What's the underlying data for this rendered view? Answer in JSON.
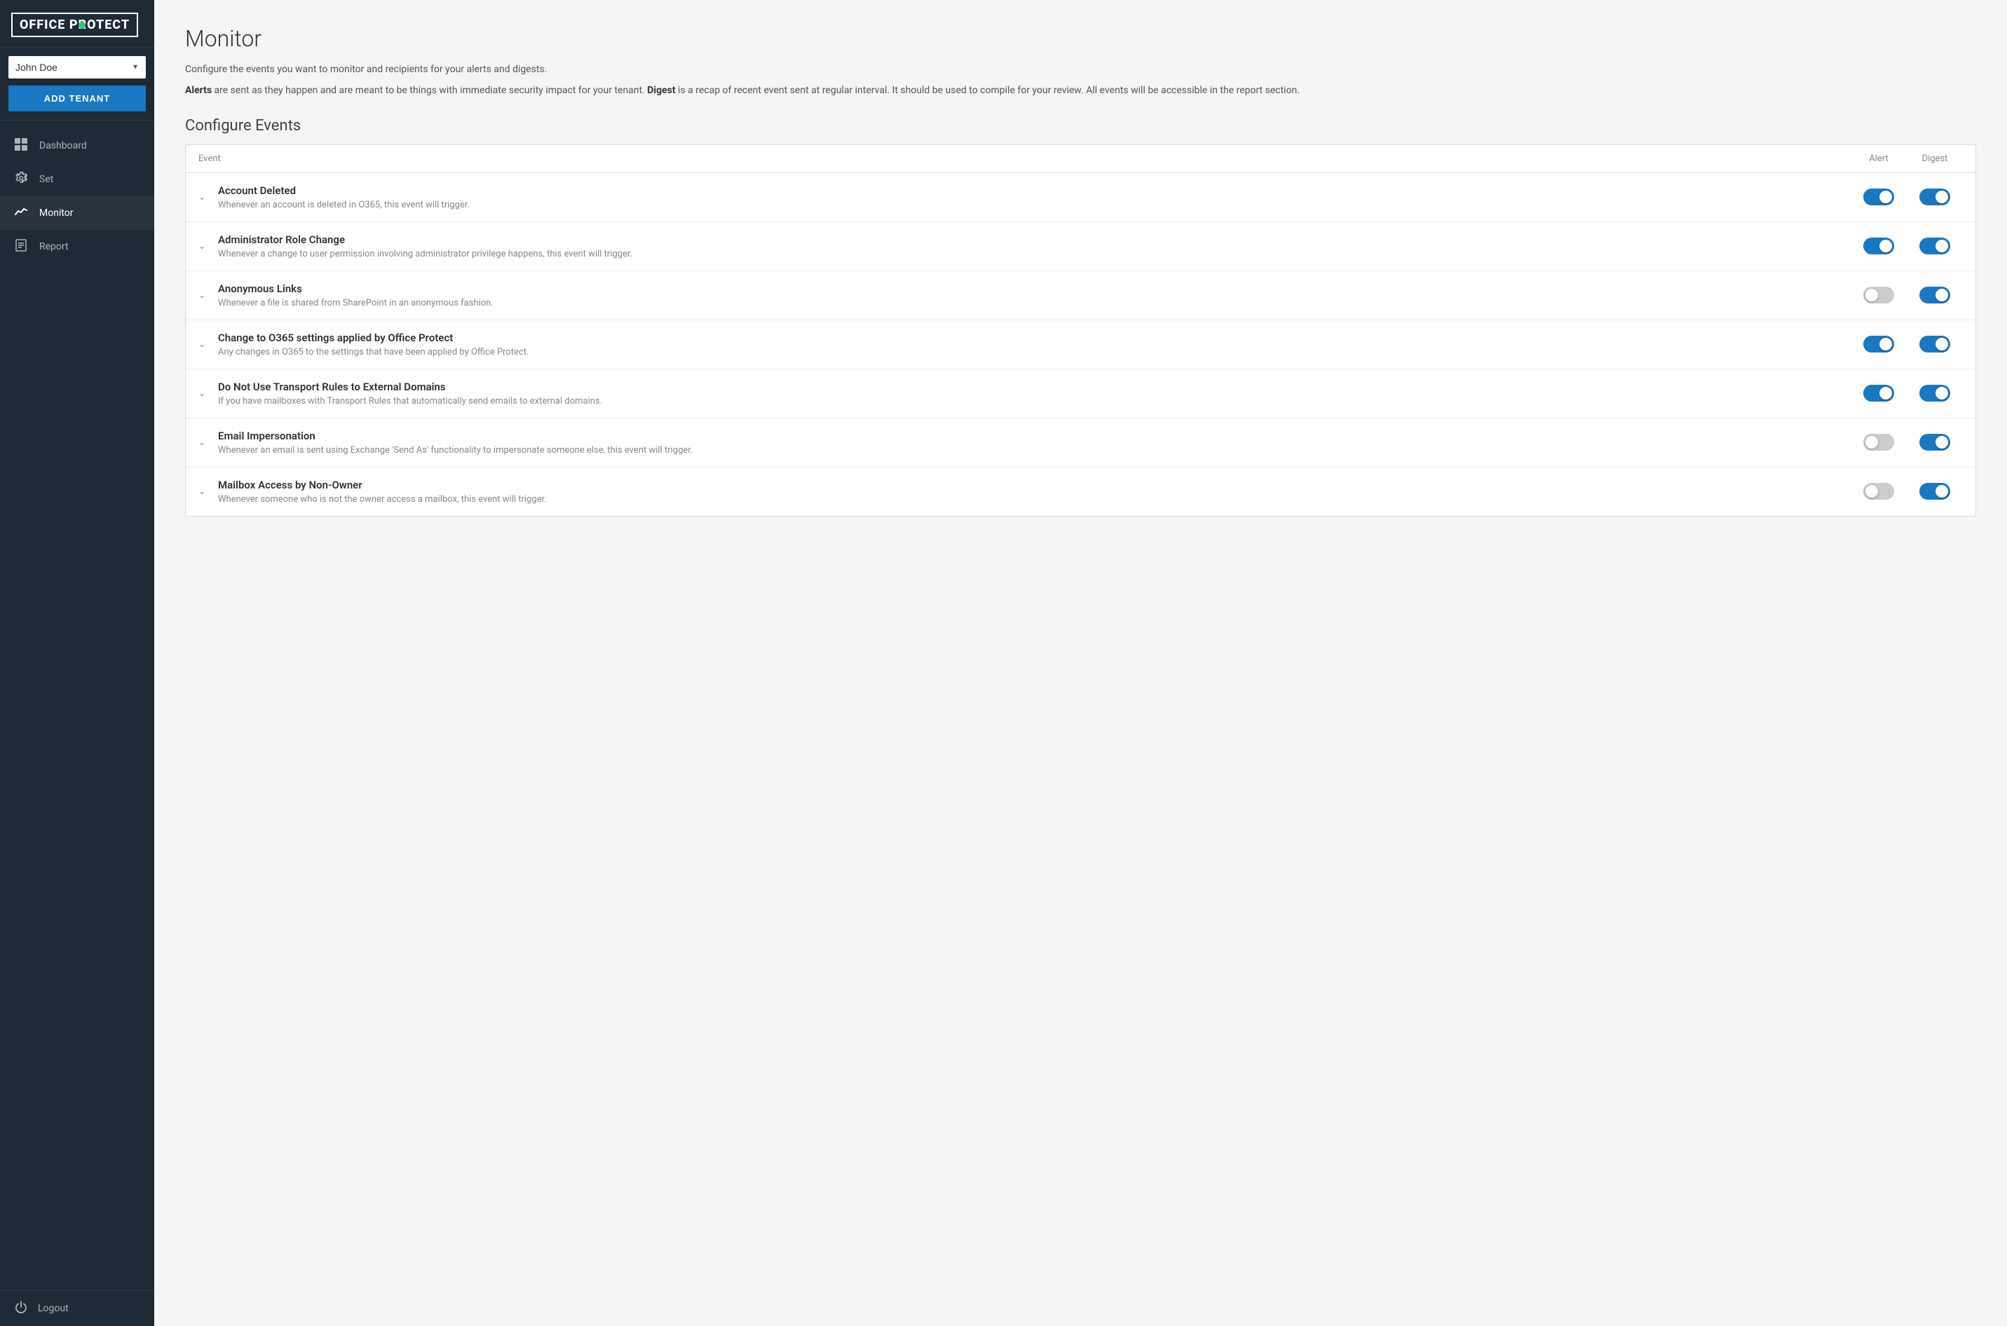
{
  "sidebar": {
    "logo_text": "OFFICE PROTECT",
    "logo_dot_color": "#2ecc71",
    "tenant": {
      "selected": "John Doe",
      "options": [
        "John Doe"
      ]
    },
    "add_tenant_label": "ADD TENANT",
    "nav_items": [
      {
        "id": "dashboard",
        "label": "Dashboard",
        "icon": "grid",
        "active": false
      },
      {
        "id": "set",
        "label": "Set",
        "icon": "gear",
        "active": false
      },
      {
        "id": "monitor",
        "label": "Monitor",
        "icon": "chart",
        "active": true
      },
      {
        "id": "report",
        "label": "Report",
        "icon": "file",
        "active": false
      }
    ],
    "logout_label": "Logout",
    "logout_icon": "power"
  },
  "main": {
    "page_title": "Monitor",
    "intro_line1": "Configure the events you want to monitor and recipients for your alerts and digests.",
    "intro_line2_bold_alerts": "Alerts",
    "intro_line2_after_alerts": " are sent as they happen and are meant to be things with immediate security impact for your tenant.",
    "intro_line2_bold_digest": "Digest",
    "intro_line2_after_digest": " is a recap of recent event sent at regular interval. It should be used to compile for your review. All events will be accessible in the report section.",
    "configure_events_title": "Configure Events",
    "table": {
      "col_event": "Event",
      "col_alert": "Alert",
      "col_digest": "Digest",
      "rows": [
        {
          "id": "account-deleted",
          "name": "Account Deleted",
          "desc": "Whenever an account is deleted in O365, this event will trigger.",
          "alert": true,
          "digest": true
        },
        {
          "id": "admin-role-change",
          "name": "Administrator Role Change",
          "desc": "Whenever a change to user permission involving administrator privilege happens, this event will trigger.",
          "alert": true,
          "digest": true
        },
        {
          "id": "anonymous-links",
          "name": "Anonymous Links",
          "desc": "Whenever a file is shared from SharePoint in an anonymous fashion.",
          "alert": false,
          "digest": true
        },
        {
          "id": "change-o365-settings",
          "name": "Change to O365 settings applied by Office Protect",
          "desc": "Any changes in O365 to the settings that have been applied by Office Protect.",
          "alert": true,
          "digest": true
        },
        {
          "id": "transport-rules",
          "name": "Do Not Use Transport Rules to External Domains",
          "desc": "If you have mailboxes with Transport Rules that automatically send emails to external domains.",
          "alert": true,
          "digest": true
        },
        {
          "id": "email-impersonation",
          "name": "Email Impersonation",
          "desc": "Whenever an email is sent using Exchange 'Send As' functionality to impersonate someone else, this event will trigger.",
          "alert": false,
          "digest": true
        },
        {
          "id": "mailbox-access",
          "name": "Mailbox Access by Non-Owner",
          "desc": "Whenever someone who is not the owner access a mailbox, this event will trigger.",
          "alert": false,
          "digest": true
        }
      ]
    }
  }
}
